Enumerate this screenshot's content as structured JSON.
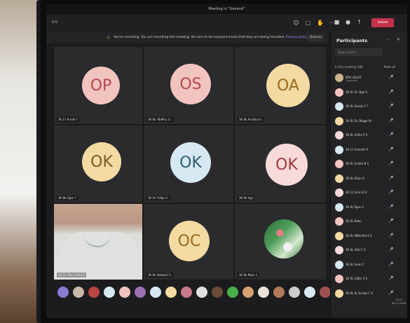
{
  "window": {
    "title": "Meeting in \"General\""
  },
  "toolbar": {
    "timer": "0:0",
    "leave_label": "Leave"
  },
  "banner": {
    "message": "You're recording. You are recording this meeting. Be sure to let everyone know that they are being recorded.",
    "link_label": "Privacy policy",
    "dismiss_label": "Dismiss"
  },
  "tiles": [
    {
      "initials": "OP",
      "bg": "#f2c4c0",
      "fg": "#b5494a",
      "label": "3K 1? Arnab ?"
    },
    {
      "initials": "OS",
      "bg": "#f2c4c0",
      "fg": "#b5494a",
      "label": "3K 6k ?BaPhu 3..."
    },
    {
      "initials": "OA",
      "bg": "#f3d9a2",
      "fg": "#9a6b1e",
      "label": "3K 6k Anubha S.."
    },
    {
      "initials": "OK",
      "bg": "#f3d9a2",
      "fg": "#7a5a22",
      "label": "3K 8k Ogm ?"
    },
    {
      "initials": "OK",
      "bg": "#d6e9f2",
      "fg": "#2d5d73",
      "label": "3K 1k ?Udip S.."
    },
    {
      "initials": "OK",
      "bg": "#f9dada",
      "fg": "#9c3a40",
      "label": "3K 6k Agn"
    },
    {
      "initials": "",
      "label": "3K 1k ?Panu Nayak"
    },
    {
      "initials": "OC",
      "bg": "#f3d9a2",
      "fg": "#9a6b1e",
      "label": "3K 6k Debashi S."
    },
    {
      "initials": "",
      "label": "3K 6k Mam 1"
    }
  ],
  "panel": {
    "title": "Participants",
    "search_placeholder": "Type a name",
    "section_label": "In this meeting (28)",
    "mute_all_label": "Mute all",
    "participants": [
      {
        "name": "MAC ALLOT",
        "sub": "Organizer",
        "color": "#c9b68c"
      },
      {
        "name": "3K 6L Dr. Bga S",
        "sub": "",
        "color": "#f2c4c0"
      },
      {
        "name": "3K 6L Sunab C ?",
        "sub": "",
        "color": "#d6e9f2"
      },
      {
        "name": "3K 6L Dr. Bkggs Ps",
        "sub": "",
        "color": "#f3d9a2"
      },
      {
        "name": "3K 6L Srdila P S",
        "sub": "",
        "color": "#f9dada"
      },
      {
        "name": "3K 1? Anmrlth P",
        "sub": "",
        "color": "#d6e9f2"
      },
      {
        "name": "3K 6L Anidla N S",
        "sub": "",
        "color": "#f2c4c0"
      },
      {
        "name": "3K 6L Dluju A",
        "sub": "",
        "color": "#f3d9a2"
      },
      {
        "name": "3K 1C Jsnm E S",
        "sub": "",
        "color": "#f9dada"
      },
      {
        "name": "3K 6L Pgun C",
        "sub": "",
        "color": "#d6e9f2"
      },
      {
        "name": "3K 6L Babu",
        "sub": "",
        "color": "#f2c4c0"
      },
      {
        "name": "3K 6L PBhkiPrd S S",
        "sub": "",
        "color": "#f3d9a2"
      },
      {
        "name": "3K 6L ASH C S",
        "sub": "",
        "color": "#f9dada"
      },
      {
        "name": "3K 6L Sumi C",
        "sub": "",
        "color": "#d6e9f2"
      },
      {
        "name": "3K 6L Gdlbr S S",
        "sub": "",
        "color": "#f2c4c0"
      },
      {
        "name": "3K 6L Al Svrawi C S",
        "sub": "",
        "color": "#f3d9a2"
      }
    ]
  },
  "strip_colors": [
    "#8a7bd0",
    "#c7b8a8",
    "#b44",
    "#d6e9f2",
    "#f2c4c0",
    "#9b6fb2",
    "#d6e9f2",
    "#f3d9a2",
    "#c8788a",
    "#e0e0e0",
    "#6a4b3a",
    "#48b048",
    "#d6a070",
    "#e9e2d8",
    "#b07a5a",
    "#ccc",
    "#d6e9f2",
    "#a05050"
  ],
  "clock": {
    "time": "13:12",
    "date": "08-11-2020"
  }
}
